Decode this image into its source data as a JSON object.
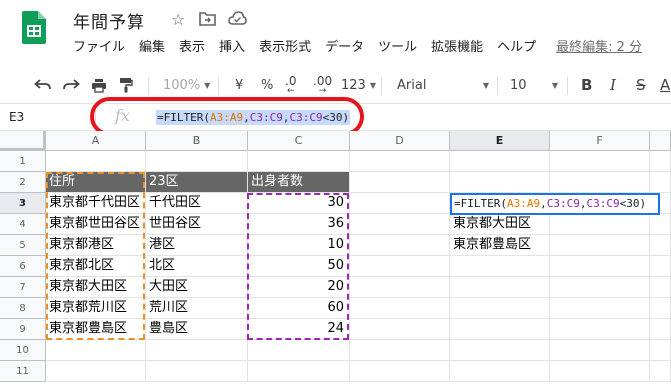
{
  "app": {
    "doc_title": "年間予算",
    "star_icon": "star-icon",
    "folder_icon": "move-folder-icon",
    "cloud_icon": "cloud-status-icon"
  },
  "menu": [
    {
      "label": "ファイル"
    },
    {
      "label": "編集"
    },
    {
      "label": "表示"
    },
    {
      "label": "挿入"
    },
    {
      "label": "表示形式"
    },
    {
      "label": "データ"
    },
    {
      "label": "ツール"
    },
    {
      "label": "拡張機能"
    },
    {
      "label": "ヘルプ"
    }
  ],
  "last_edit": "最終編集: 2 分",
  "toolbar": {
    "zoom": "100%",
    "currency": "¥",
    "percent": "%",
    "dec_decrease": ".0",
    "dec_increase": ".00",
    "more_formats": "123",
    "font": "Arial",
    "font_size": "10",
    "bold": "B",
    "italic": "I",
    "strike": "S",
    "text_color": "A"
  },
  "formula_bar": {
    "cell_ref": "E3",
    "fx": "fx",
    "formula_parts": [
      "=FILTER(",
      "A3:A9",
      ",",
      "C3:C9",
      ",",
      "C3:C9",
      "<30)"
    ]
  },
  "columns": [
    "A",
    "B",
    "C",
    "D",
    "E",
    "F"
  ],
  "rows": [
    "1",
    "2",
    "3",
    "4",
    "5",
    "6",
    "7",
    "8",
    "9",
    "10",
    "11"
  ],
  "headers": {
    "a": "住所",
    "b": "23区",
    "c": "出身者数"
  },
  "table": [
    {
      "address": "東京都千代田区",
      "ward": "千代田区",
      "count": "30"
    },
    {
      "address": "東京都世田谷区",
      "ward": "世田谷区",
      "count": "36"
    },
    {
      "address": "東京都港区",
      "ward": "港区",
      "count": "10"
    },
    {
      "address": "東京都北区",
      "ward": "北区",
      "count": "50"
    },
    {
      "address": "東京都大田区",
      "ward": "大田区",
      "count": "20"
    },
    {
      "address": "東京都荒川区",
      "ward": "荒川区",
      "count": "60"
    },
    {
      "address": "東京都豊島区",
      "ward": "豊島区",
      "count": "24"
    }
  ],
  "results": [
    "東京都大田区",
    "東京都豊島区"
  ],
  "colors": {
    "header_fill": "#666666",
    "range_a": "#e37400",
    "range_c": "#8e24aa",
    "selection": "#1a73e8",
    "annotation": "#e8141c",
    "logo": "#0f9d58"
  }
}
